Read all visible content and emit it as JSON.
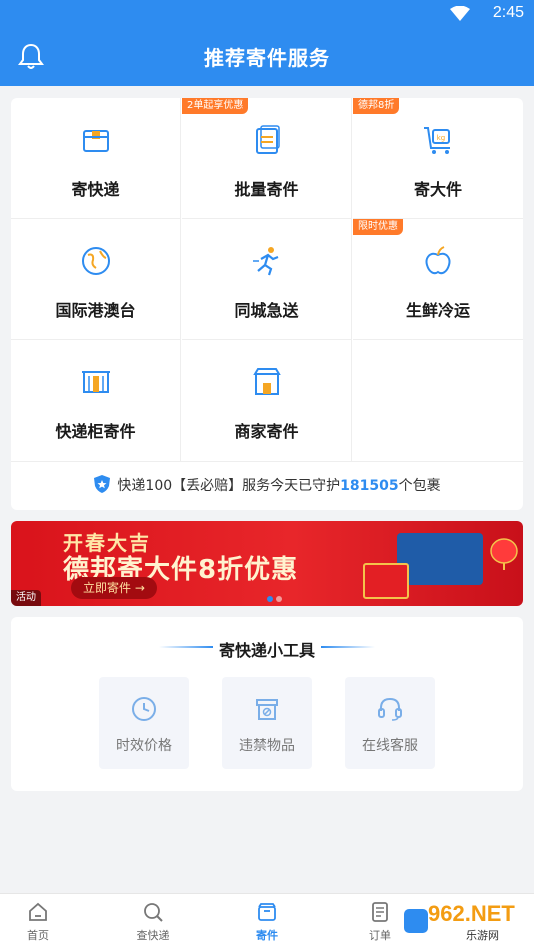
{
  "status_bar": {
    "time": "2:45"
  },
  "header": {
    "title": "推荐寄件服务"
  },
  "services": [
    {
      "label": "寄快递",
      "badge": "",
      "icon": "package-icon"
    },
    {
      "label": "批量寄件",
      "badge": "2单起享优惠",
      "icon": "document-stack-icon"
    },
    {
      "label": "寄大件",
      "badge": "德邦8折",
      "icon": "cart-kg-icon"
    },
    {
      "label": "国际港澳台",
      "badge": "",
      "icon": "globe-icon"
    },
    {
      "label": "同城急送",
      "badge": "",
      "icon": "runner-icon"
    },
    {
      "label": "生鲜冷运",
      "badge": "限时优惠",
      "icon": "apple-icon"
    },
    {
      "label": "快递柜寄件",
      "badge": "",
      "icon": "locker-icon"
    },
    {
      "label": "商家寄件",
      "badge": "",
      "icon": "storefront-icon"
    }
  ],
  "guarantee": {
    "prefix": "快递100【丢必赔】服务今天已守护",
    "count": "181505",
    "suffix": "个包裹"
  },
  "banner": {
    "line1": "开春大吉",
    "line2": "德邦寄大件8折优惠",
    "cta": "立即寄件 →",
    "tag": "活动"
  },
  "tools": {
    "title": "寄快递小工具",
    "items": [
      {
        "label": "时效价格",
        "icon": "clock-icon"
      },
      {
        "label": "违禁物品",
        "icon": "prohibited-box-icon"
      },
      {
        "label": "在线客服",
        "icon": "headset-icon"
      }
    ]
  },
  "tabs": [
    {
      "label": "首页",
      "icon": "home-icon"
    },
    {
      "label": "查快递",
      "icon": "search-icon"
    },
    {
      "label": "寄件",
      "icon": "send-box-icon"
    },
    {
      "label": "订单",
      "icon": "order-list-icon"
    }
  ],
  "watermark": {
    "brand": "962.NET",
    "sub": "乐游网"
  },
  "colors": {
    "primary": "#2e8cf0",
    "badge": "#ff7a2a",
    "banner_red": "#e8262a"
  }
}
